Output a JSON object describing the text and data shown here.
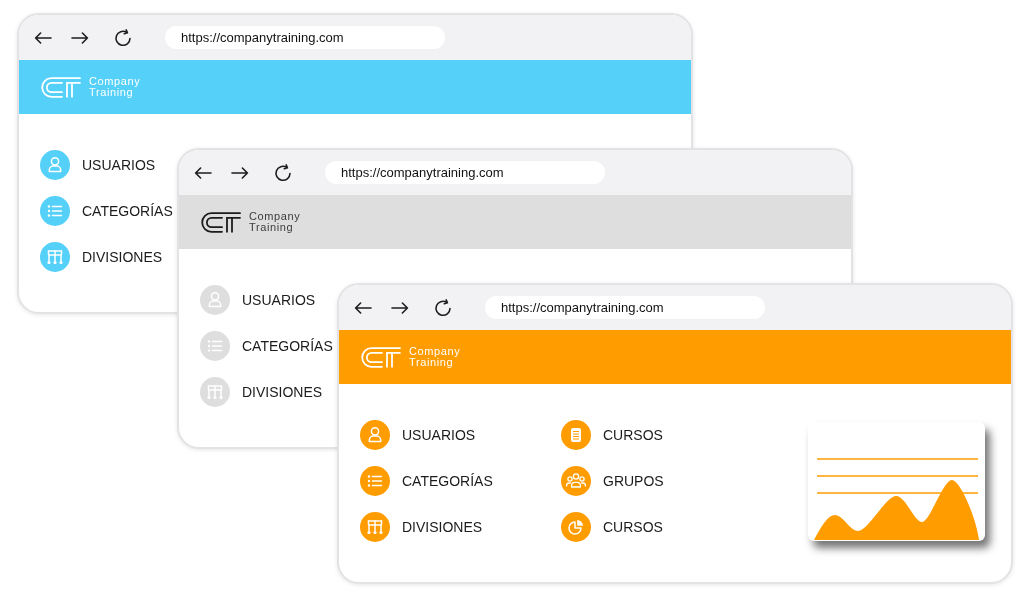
{
  "windows": [
    {
      "url": "https://companytraining.com",
      "color": "#55d0f8",
      "brand": [
        "Company",
        "Training"
      ],
      "menu": [
        "USUARIOS",
        "CATEGORÍAS",
        "DIVISIONES"
      ]
    },
    {
      "url": "https://companytraining.com",
      "color": "#dedede",
      "brand": [
        "Company",
        "Training"
      ],
      "menu": [
        "USUARIOS",
        "CATEGORÍAS",
        "DIVISIONES"
      ]
    },
    {
      "url": "https://companytraining.com",
      "color": "#ff9c00",
      "brand": [
        "Company",
        "Training"
      ],
      "menu": [
        "USUARIOS",
        "CATEGORÍAS",
        "DIVISIONES",
        "CURSOS",
        "GRUPOS",
        "CURSOS"
      ],
      "chart_card": true
    }
  ]
}
